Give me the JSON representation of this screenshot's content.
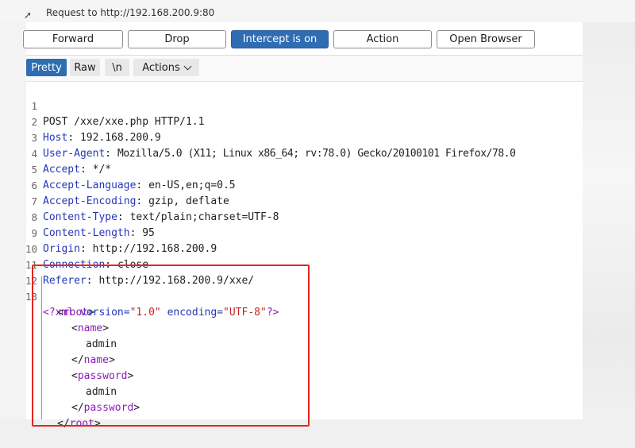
{
  "top": {
    "request_title": "Request to http://192.168.200.9:80"
  },
  "toolbar": {
    "forward": "Forward",
    "drop": "Drop",
    "intercept": "Intercept is on",
    "action": "Action",
    "open_browser": "Open Browser"
  },
  "view_tabs": {
    "pretty": "Pretty",
    "raw": "Raw",
    "newline": "\\n",
    "actions": "Actions"
  },
  "request": {
    "line_numbers": [
      "1",
      "2",
      "3",
      "4",
      "5",
      "6",
      "7",
      "8",
      "9",
      "10",
      "11",
      "12",
      "13",
      "",
      "",
      "",
      "",
      "",
      "",
      "",
      ""
    ],
    "request_line": "POST /xxe/xxe.php HTTP/1.1",
    "headers": [
      {
        "name": "Host",
        "value": "192.168.200.9"
      },
      {
        "name": "User-Agent",
        "value": "Mozilla/5.0 (X11; Linux x86_64; rv:78.0) Gecko/20100101 Firefox/78.0"
      },
      {
        "name": "Accept",
        "value": "*/*"
      },
      {
        "name": "Accept-Language",
        "value": "en-US,en;q=0.5"
      },
      {
        "name": "Accept-Encoding",
        "value": "gzip, deflate"
      },
      {
        "name": "Content-Type",
        "value": "text/plain;charset=UTF-8"
      },
      {
        "name": "Content-Length",
        "value": "95"
      },
      {
        "name": "Origin",
        "value": "http://192.168.200.9"
      },
      {
        "name": "Connection",
        "value": "close"
      },
      {
        "name": "Referer",
        "value": "http://192.168.200.9/xxe/"
      }
    ],
    "xml": {
      "decl_open": "<?xml",
      "version_attr": "version=",
      "version_val": "\"1.0\"",
      "encoding_attr": "encoding=",
      "encoding_val": "\"UTF-8\"",
      "decl_close": "?>",
      "root_tag": "root",
      "name_tag": "name",
      "name_value": "admin",
      "password_tag": "password",
      "password_value": "admin"
    }
  },
  "colors": {
    "accent": "#2e6db1",
    "header_name": "#2437b8",
    "xml_tag": "#8c1bb8",
    "xml_string": "#c42525",
    "highlight_box": "#e3261f"
  },
  "icons": [
    "arrow-icon",
    "chevron-down-icon"
  ]
}
